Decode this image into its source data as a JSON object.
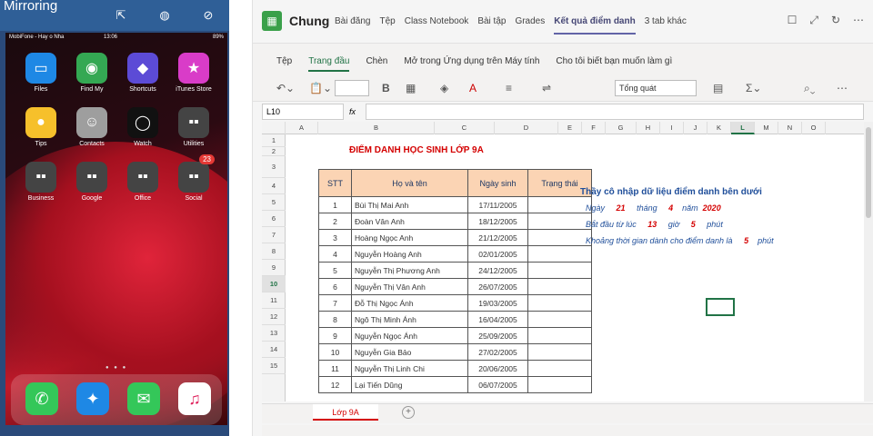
{
  "mirroring": {
    "title": "Mirroring"
  },
  "ios": {
    "status": {
      "carrier": "MobiFone - Hay o Nha",
      "time": "13:06",
      "battery": "89%"
    },
    "apps": [
      {
        "label": "Files",
        "icon": "files-icon",
        "color": "#1e88e5"
      },
      {
        "label": "Find My",
        "icon": "find-my-icon",
        "color": "#34a853"
      },
      {
        "label": "Shortcuts",
        "icon": "shortcuts-icon",
        "color": "#5c4bd6"
      },
      {
        "label": "iTunes Store",
        "icon": "itunes-store-icon",
        "color": "#d93cc8"
      },
      {
        "label": "Tips",
        "icon": "tips-icon",
        "color": "#f6c02b"
      },
      {
        "label": "Contacts",
        "icon": "contacts-icon",
        "color": "#9e9e9e"
      },
      {
        "label": "Watch",
        "icon": "watch-icon",
        "color": "#111111"
      },
      {
        "label": "Utilities",
        "icon": "utilities-folder-icon",
        "color": "#444444"
      },
      {
        "label": "Business",
        "icon": "business-folder-icon",
        "color": "#444444"
      },
      {
        "label": "Google",
        "icon": "google-folder-icon",
        "color": "#444444"
      },
      {
        "label": "Office",
        "icon": "office-folder-icon",
        "color": "#444444"
      },
      {
        "label": "Social",
        "icon": "social-folder-icon",
        "color": "#444444",
        "badge": "23"
      }
    ],
    "dock": [
      {
        "icon": "phone-icon",
        "color": "#34c759"
      },
      {
        "icon": "safari-icon",
        "color": "#1e88e5"
      },
      {
        "icon": "messages-icon",
        "color": "#34c759"
      },
      {
        "icon": "music-icon",
        "color": "#ffffff"
      }
    ]
  },
  "teams": {
    "team_name": "Chung",
    "team_avatar_color": "#3aa04a",
    "tabs": [
      "Bài đăng",
      "Tệp",
      "Class Notebook",
      "Bài tập",
      "Grades",
      "Kết quả điểm danh",
      "3 tab khác"
    ]
  },
  "ribbon": {
    "tabs": [
      "Tệp",
      "Trang đầu",
      "Chèn",
      "Mở trong Ứng dụng trên Máy tính",
      "Cho tôi biết bạn muốn làm gì"
    ],
    "number_format": "Tổng quát"
  },
  "formula": {
    "namebox": "L10",
    "fx": "fx"
  },
  "sheet": {
    "columns": [
      "A",
      "B",
      "C",
      "D",
      "E",
      "F",
      "G",
      "H",
      "I",
      "J",
      "K",
      "L",
      "M",
      "N",
      "O"
    ],
    "selected_col": "L",
    "selected_row": "10",
    "rows": [
      "1",
      "2",
      "3",
      "4",
      "5",
      "6",
      "7",
      "8",
      "9",
      "10",
      "11",
      "12",
      "13",
      "14",
      "15"
    ],
    "title": "ĐIỂM DANH HỌC SINH LỚP 9A",
    "headers": [
      "STT",
      "Họ và tên",
      "Ngày sinh",
      "Trạng thái"
    ],
    "students": [
      [
        "1",
        "Bùi Thị Mai Anh",
        "17/11/2005"
      ],
      [
        "2",
        "Đoàn Vân Anh",
        "18/12/2005"
      ],
      [
        "3",
        "Hoàng Ngọc Anh",
        "21/12/2005"
      ],
      [
        "4",
        "Nguyễn Hoàng Anh",
        "02/01/2005"
      ],
      [
        "5",
        "Nguyễn Thị Phương Anh",
        "24/12/2005"
      ],
      [
        "6",
        "Nguyễn Thị Vân Anh",
        "26/07/2005"
      ],
      [
        "7",
        "Đỗ Thị Ngọc Ánh",
        "19/03/2005"
      ],
      [
        "8",
        "Ngô Thị Minh Ánh",
        "16/04/2005"
      ],
      [
        "9",
        "Nguyễn Ngọc Ánh",
        "25/09/2005"
      ],
      [
        "10",
        "Nguyễn Gia Bảo",
        "27/02/2005"
      ],
      [
        "11",
        "Nguyễn Thị Linh Chi",
        "20/06/2005"
      ],
      [
        "12",
        "Lại Tiến Dũng",
        "06/07/2005"
      ]
    ],
    "notes": {
      "heading": "Thầy cô nhập dữ liệu điểm danh bên dưới",
      "ngay_label": "Ngày",
      "ngay": "21",
      "thang_label": "tháng",
      "thang": "4",
      "nam_label": "năm",
      "nam": "2020",
      "start_label": "Bắt đầu từ lúc",
      "gio": "13",
      "gio_label": "giờ",
      "phut": "5",
      "phut_label": "phút",
      "duration_label": "Khoảng thời gian dành cho điểm danh là",
      "duration": "5",
      "duration_unit": "phút"
    },
    "sheet_tab": "Lớp 9A"
  }
}
